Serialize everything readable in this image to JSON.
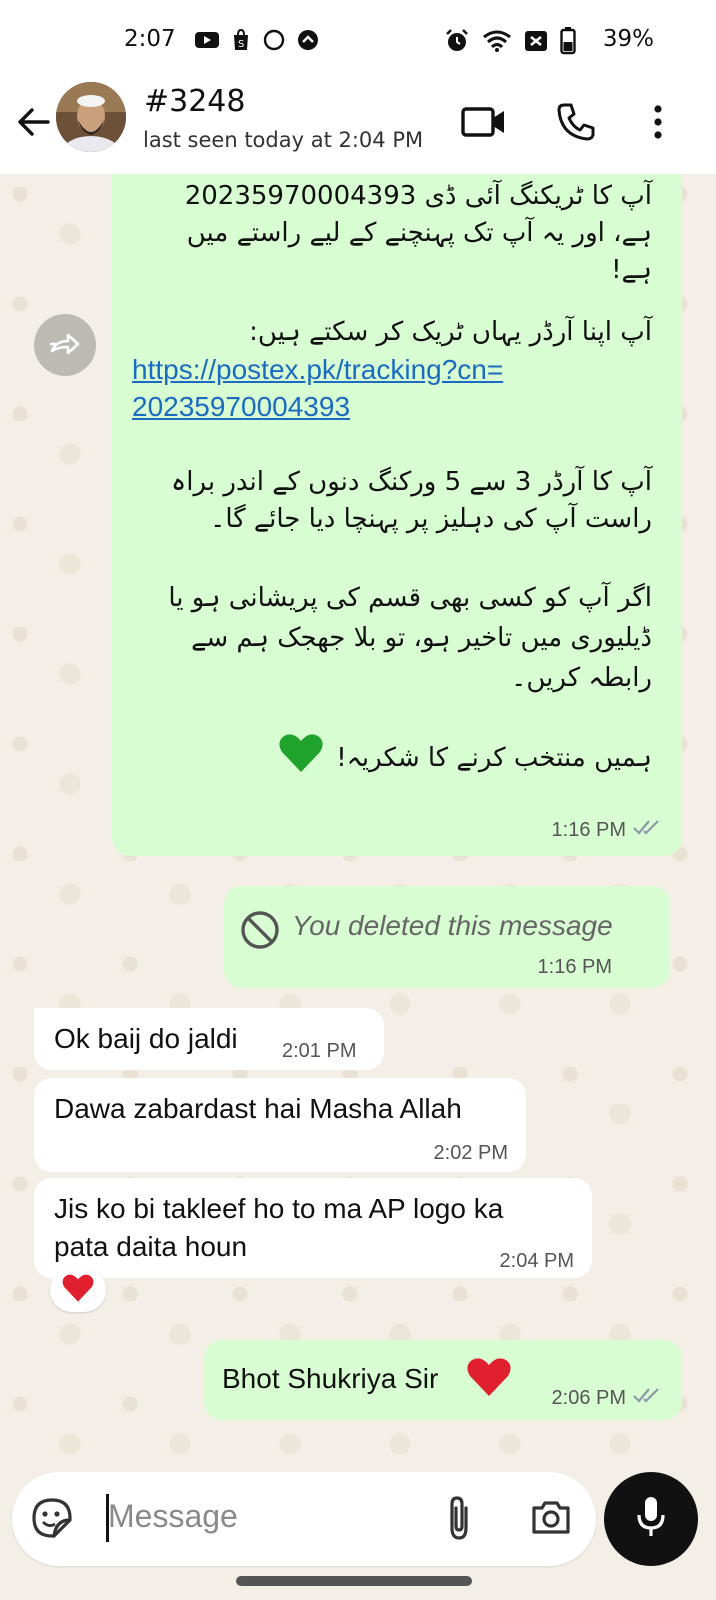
{
  "status_bar": {
    "time": "2:07",
    "battery": "39%",
    "left_icons": [
      "youtube-icon",
      "shopify-icon",
      "circle-icon",
      "dot-circle-icon"
    ],
    "right_icons": [
      "alarm-icon",
      "wifi-icon",
      "signal-x-icon",
      "battery-icon"
    ]
  },
  "header": {
    "name": "#3248",
    "status": "last seen today at 2:04 PM",
    "icons": [
      "back-arrow-icon",
      "video-call-icon",
      "phone-icon",
      "more-vert-icon"
    ]
  },
  "messages": [
    {
      "direction": "out",
      "lines_top": [
        "آپ کا ٹریکنگ آئی ڈی 20235970004393",
        "ہے، اور یہ آپ تک پہنچنے کے لیے راستے میں",
        "ہے!",
        "",
        "آپ اپنا آرڈر یہاں ٹریک کر سکتے ہیں:"
      ],
      "link_line1": "https://postex.pk/tracking?cn=",
      "link_line2": "20235970004393",
      "lines_bottom": [
        "آپ کا آرڈر 3 سے 5 ورکنگ دنوں کے اندر براہ",
        "راست آپ کی دہلیز پر پہنچا دیا جائے گا۔",
        "",
        "اگر آپ کو کسی بھی قسم کی پریشانی ہو یا",
        "ڈیلیوری میں تاخیر ہو، تو بلا جھجک ہم سے",
        "رابطہ کریں۔",
        "",
        "ہمیں منتخب کرنے کا شکریہ!"
      ],
      "time": "1:16 PM",
      "read": true
    },
    {
      "direction": "out",
      "text": "You deleted this message",
      "time": "1:16 PM",
      "deleted": true
    },
    {
      "direction": "in",
      "text": "Ok baij do jaldi",
      "time": "2:01 PM"
    },
    {
      "direction": "in",
      "text": "Dawa zabardast hai Masha Allah",
      "time": "2:02 PM"
    },
    {
      "direction": "in",
      "line1": "Jis ko bi takleef ho to ma AP logo ka",
      "line2": "pata daita houn",
      "time": "2:04 PM",
      "reaction": "red-heart"
    },
    {
      "direction": "out",
      "text": "Bhot Shukriya Sir",
      "time": "2:06 PM",
      "read": true,
      "emoji": "red-heart"
    }
  ],
  "composer": {
    "placeholder": "Message",
    "icons": [
      "sticker-icon",
      "attach-icon",
      "camera-icon",
      "mic-icon"
    ]
  },
  "colors": {
    "outgoing_bubble": "#d9fdd3",
    "incoming_bubble": "#ffffff",
    "link": "#1b6cc0",
    "chat_background": "#f3efe6",
    "read_ticks": "#8a9aa6"
  }
}
